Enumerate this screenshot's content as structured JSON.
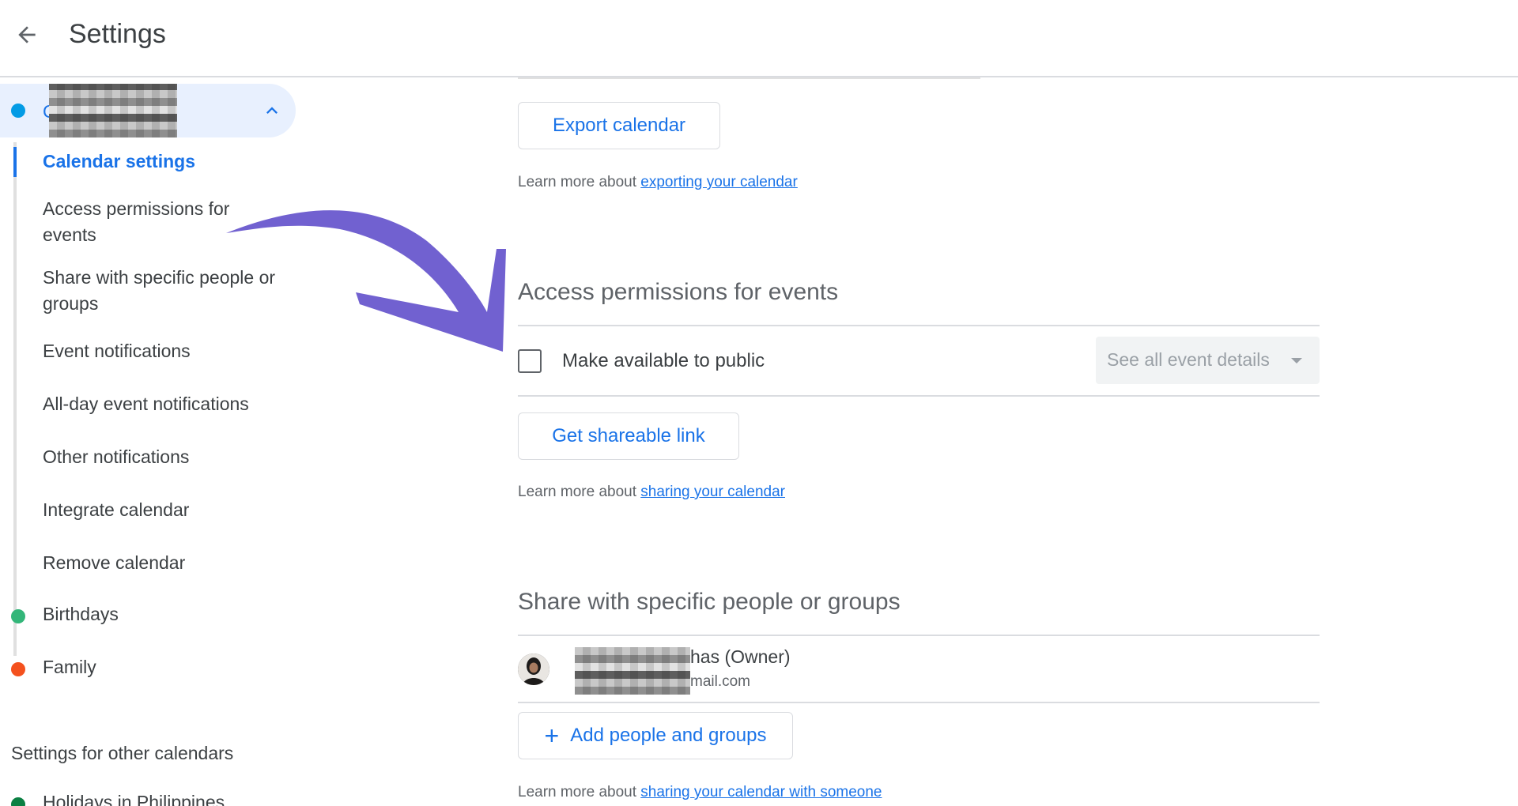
{
  "header": {
    "title": "Settings"
  },
  "sidebar": {
    "calendar_head_label": "C                 s",
    "items": [
      {
        "label": "Calendar settings"
      },
      {
        "label": "Access permissions for events"
      },
      {
        "label": "Share with specific people or groups"
      },
      {
        "label": "Event notifications"
      },
      {
        "label": "All-day event notifications"
      },
      {
        "label": "Other notifications"
      },
      {
        "label": "Integrate calendar"
      },
      {
        "label": "Remove calendar"
      }
    ],
    "calendars": [
      {
        "label": "Birthdays",
        "color": "#33b679"
      },
      {
        "label": "Family",
        "color": "#f4511e"
      }
    ],
    "other_section_title": "Settings for other calendars",
    "other_calendars": [
      {
        "label": "Holidays in Philippines",
        "color": "#0b8043"
      }
    ]
  },
  "main": {
    "export_button": "Export calendar",
    "export_learn_prefix": "Learn more about ",
    "export_learn_link": "exporting your calendar",
    "access_title": "Access permissions for events",
    "public_label": "Make available to public",
    "public_select_value": "See all event details",
    "shareable_button": "Get shareable link",
    "share_learn_prefix": "Learn more about ",
    "share_learn_link": "sharing your calendar",
    "share_title": "Share with specific people or groups",
    "owner_name_suffix": "has (Owner)",
    "owner_email_suffix": "mail.com",
    "add_people_button": "Add people and groups",
    "add_people_icon": "+",
    "someone_learn_prefix": "Learn more about ",
    "someone_learn_link": "sharing your calendar with someone"
  },
  "colors": {
    "accent": "#1a73e8",
    "selected_bg": "#e8f0fe",
    "arrow": "#7161d0"
  }
}
